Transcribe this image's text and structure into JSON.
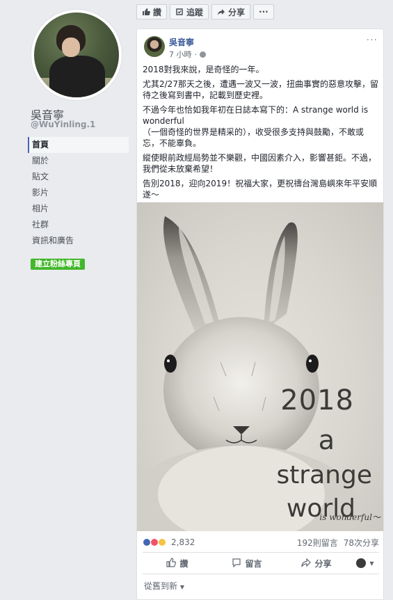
{
  "topbar": {
    "like": "讚",
    "follow": "追蹤",
    "share": "分享",
    "more": "···"
  },
  "profile": {
    "name": "吳音寧",
    "handle": "@WuYinling.1",
    "nav": [
      "首頁",
      "關於",
      "貼文",
      "影片",
      "相片",
      "社群",
      "資訊和廣告"
    ],
    "create_page": "建立粉絲專頁"
  },
  "post": {
    "author": "吳音寧",
    "time": "7 小時",
    "more": "···",
    "paragraphs": [
      "2018對我來說，是奇怪的一年。",
      "尤其2/27那天之後，遭遇一波又一波，扭曲事實的惡意攻擊，留待之後寫到書中，記載到歷史裡。",
      "不過今年也恰如我年初在日誌本寫下的：A strange world is wonderful\n（一個奇怪的世界是精采的），收受很多支持與鼓勵，不敢或忘，不能辜負。",
      "縱使眼前政經局勢並不樂觀，中國因素介入，影響甚鉅。不過，我們從未放棄希望！",
      "告別2018，迎向2019！祝福大家，更祝禱台灣島嶼來年平安順遂～"
    ],
    "image_text": {
      "year": "2018",
      "a": "a",
      "strange": "strange",
      "world": "world",
      "wonderful": "is wonderful～"
    },
    "reaction_count": "2,832",
    "comments": "192則留言",
    "shares": "78次分享",
    "actions": {
      "like": "讚",
      "comment": "留言",
      "share": "分享"
    },
    "sort": "從舊到新"
  },
  "colors": {
    "link": "#385898",
    "accent": "#4267b2",
    "green": "#42b72a"
  }
}
